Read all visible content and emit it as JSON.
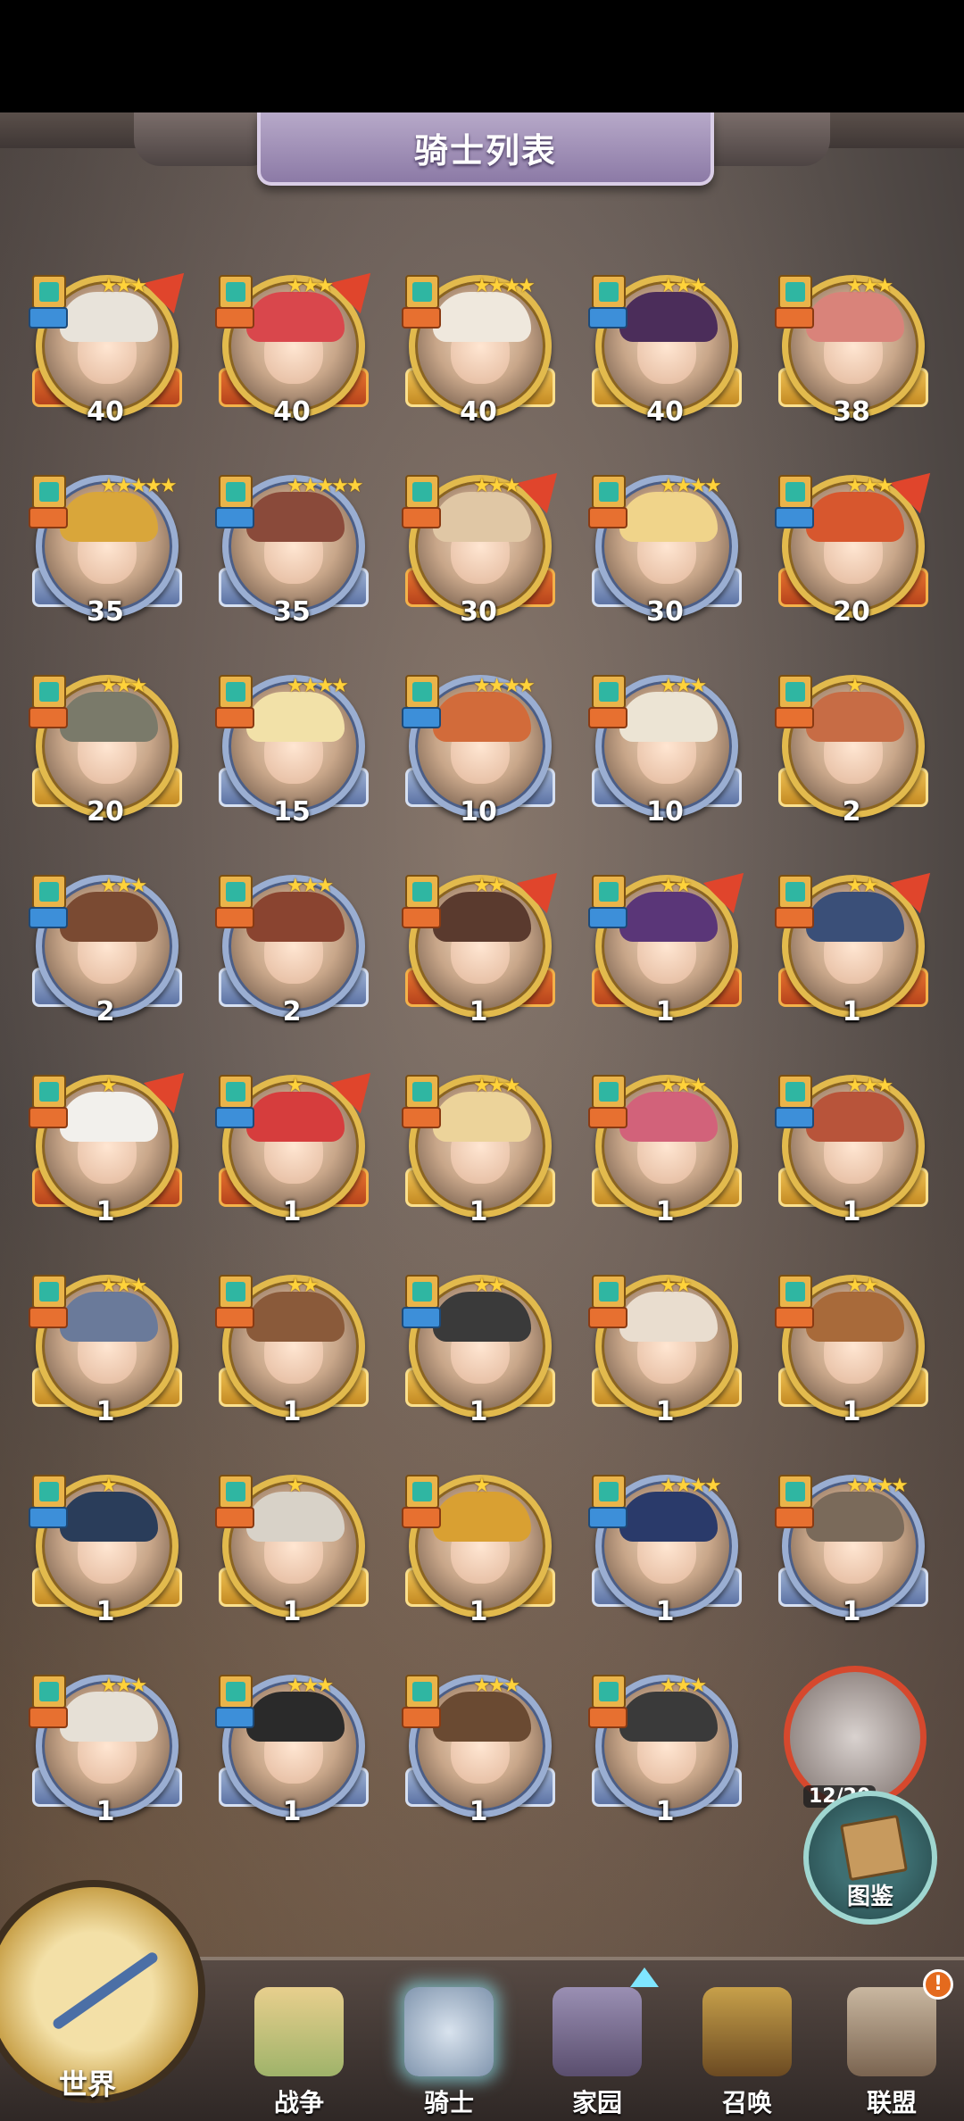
{
  "title": "骑士列表",
  "knights": [
    {
      "level": "40",
      "stars": "★★★",
      "rim": "red",
      "hair": "#e8e3da"
    },
    {
      "level": "40",
      "stars": "★★★",
      "rim": "red",
      "hair": "#d9474c"
    },
    {
      "level": "40",
      "stars": "★★★★",
      "rim": "gold",
      "hair": "#efe8dd"
    },
    {
      "level": "40",
      "stars": "★★★",
      "rim": "gold",
      "hair": "#4b2d5a"
    },
    {
      "level": "38",
      "stars": "★★★",
      "rim": "gold",
      "hair": "#d9837a"
    },
    {
      "level": "35",
      "stars": "★★★★★",
      "rim": "blue",
      "hair": "#d9a63a"
    },
    {
      "level": "35",
      "stars": "★★★★★",
      "rim": "blue",
      "hair": "#8a4a3a"
    },
    {
      "level": "30",
      "stars": "★★★",
      "rim": "red",
      "hair": "#e0c7a5"
    },
    {
      "level": "30",
      "stars": "★★★★",
      "rim": "blue",
      "hair": "#f0d48a"
    },
    {
      "level": "20",
      "stars": "★★★",
      "rim": "red",
      "hair": "#d7572e"
    },
    {
      "level": "20",
      "stars": "★★★",
      "rim": "gold",
      "hair": "#7a7a6a"
    },
    {
      "level": "15",
      "stars": "★★★★",
      "rim": "blue",
      "hair": "#f2e1a8"
    },
    {
      "level": "10",
      "stars": "★★★★",
      "rim": "blue",
      "hair": "#d26b3a"
    },
    {
      "level": "10",
      "stars": "★★★",
      "rim": "blue",
      "hair": "#ece4d4"
    },
    {
      "level": "2",
      "stars": "★",
      "rim": "gold",
      "hair": "#c76c45"
    },
    {
      "level": "2",
      "stars": "★★★",
      "rim": "blue",
      "hair": "#7a4a32"
    },
    {
      "level": "2",
      "stars": "★★★",
      "rim": "blue",
      "hair": "#8a4430"
    },
    {
      "level": "1",
      "stars": "★★",
      "rim": "red",
      "hair": "#5a3a2e"
    },
    {
      "level": "1",
      "stars": "★★",
      "rim": "red",
      "hair": "#5a3678"
    },
    {
      "level": "1",
      "stars": "★★",
      "rim": "red",
      "hair": "#3a4f78"
    },
    {
      "level": "1",
      "stars": "★",
      "rim": "red",
      "hair": "#f2f0ec"
    },
    {
      "level": "1",
      "stars": "★",
      "rim": "red",
      "hair": "#d63d3d"
    },
    {
      "level": "1",
      "stars": "★★★",
      "rim": "gold",
      "hair": "#ecd39a"
    },
    {
      "level": "1",
      "stars": "★★★",
      "rim": "gold",
      "hair": "#d2627a"
    },
    {
      "level": "1",
      "stars": "★★★",
      "rim": "gold",
      "hair": "#b8543a"
    },
    {
      "level": "1",
      "stars": "★★★",
      "rim": "gold",
      "hair": "#6a7a9a"
    },
    {
      "level": "1",
      "stars": "★★",
      "rim": "gold",
      "hair": "#8a5a3a"
    },
    {
      "level": "1",
      "stars": "★★",
      "rim": "gold",
      "hair": "#3a3a3a"
    },
    {
      "level": "1",
      "stars": "★★",
      "rim": "gold",
      "hair": "#e9ddcf"
    },
    {
      "level": "1",
      "stars": "★★",
      "rim": "gold",
      "hair": "#a86a3a"
    },
    {
      "level": "1",
      "stars": "★",
      "rim": "gold",
      "hair": "#2a3d5a"
    },
    {
      "level": "1",
      "stars": "★",
      "rim": "gold",
      "hair": "#d8d2c8"
    },
    {
      "level": "1",
      "stars": "★",
      "rim": "gold",
      "hair": "#d9a032"
    },
    {
      "level": "1",
      "stars": "★★★★",
      "rim": "blue",
      "hair": "#2a3a6a"
    },
    {
      "level": "1",
      "stars": "★★★★",
      "rim": "blue",
      "hair": "#7a6a5a"
    },
    {
      "level": "1",
      "stars": "★★★",
      "rim": "blue",
      "hair": "#e6e0d6"
    },
    {
      "level": "1",
      "stars": "★★★",
      "rim": "blue",
      "hair": "#2a2a2a"
    },
    {
      "level": "1",
      "stars": "★★★",
      "rim": "blue",
      "hair": "#6a4a32"
    },
    {
      "level": "1",
      "stars": "★★★",
      "rim": "blue",
      "hair": "#3a3a3a"
    }
  ],
  "special": {
    "progress": "12/20"
  },
  "compendium_label": "图鉴",
  "nav": {
    "world": "世界",
    "war": "战争",
    "knight": "骑士",
    "home": "家园",
    "summon": "召唤",
    "alliance": "联盟",
    "alert": "!"
  }
}
